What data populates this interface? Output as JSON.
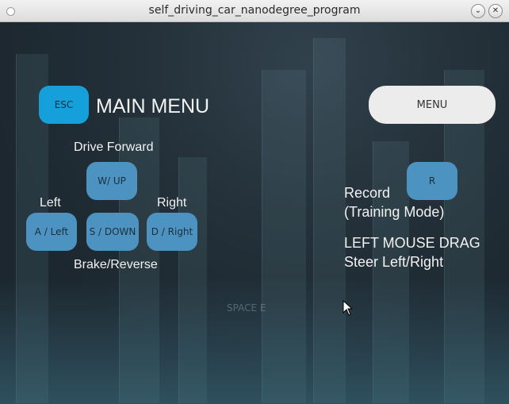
{
  "window": {
    "title": "self_driving_car_nanodegree_program",
    "minimize_icon": "chevron-down-icon",
    "close_icon": "close-icon"
  },
  "header": {
    "esc_label": "ESC",
    "main_menu_title": "MAIN MENU",
    "menu_label": "MENU"
  },
  "controls": {
    "drive_forward": "Drive Forward",
    "forward_key": "W/ UP",
    "left": "Left",
    "right": "Right",
    "left_key": "A / Left",
    "down_key": "S / DOWN",
    "right_key": "D / Right",
    "brake_reverse": "Brake/Reverse"
  },
  "record": {
    "key": "R",
    "line1": "Record",
    "line2": "(Training Mode)"
  },
  "steer": {
    "line1": "LEFT MOUSE DRAG",
    "line2": "Steer Left/Right"
  },
  "background_hint": "SPACE E"
}
